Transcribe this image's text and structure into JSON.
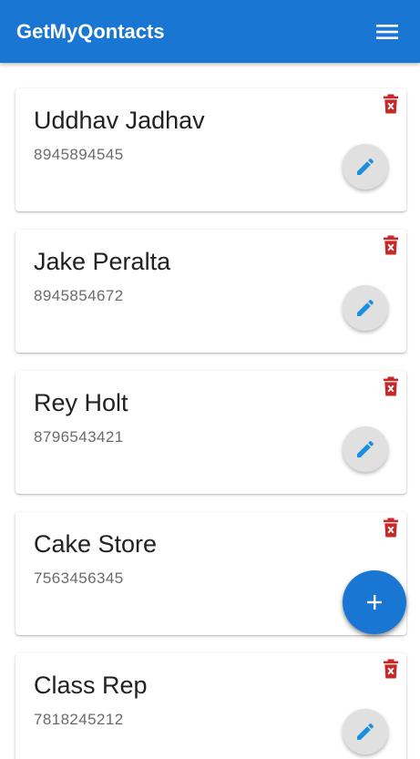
{
  "appbar": {
    "title": "GetMyQontacts",
    "menu_icon": "menu-icon"
  },
  "contacts": [
    {
      "name": "Uddhav Jadhav",
      "phone": "8945894545"
    },
    {
      "name": "Jake Peralta",
      "phone": "8945854672"
    },
    {
      "name": "Rey Holt",
      "phone": "8796543421"
    },
    {
      "name": "Cake Store",
      "phone": "7563456345"
    },
    {
      "name": "Class Rep",
      "phone": "7818245212"
    }
  ],
  "icons": {
    "delete": "delete-icon",
    "edit": "pencil-icon",
    "add": "plus-icon"
  },
  "colors": {
    "primary": "#1976d2",
    "delete": "#c62828",
    "edit_icon": "#1a8fe0",
    "edit_button_bg": "#e0e0e0"
  }
}
